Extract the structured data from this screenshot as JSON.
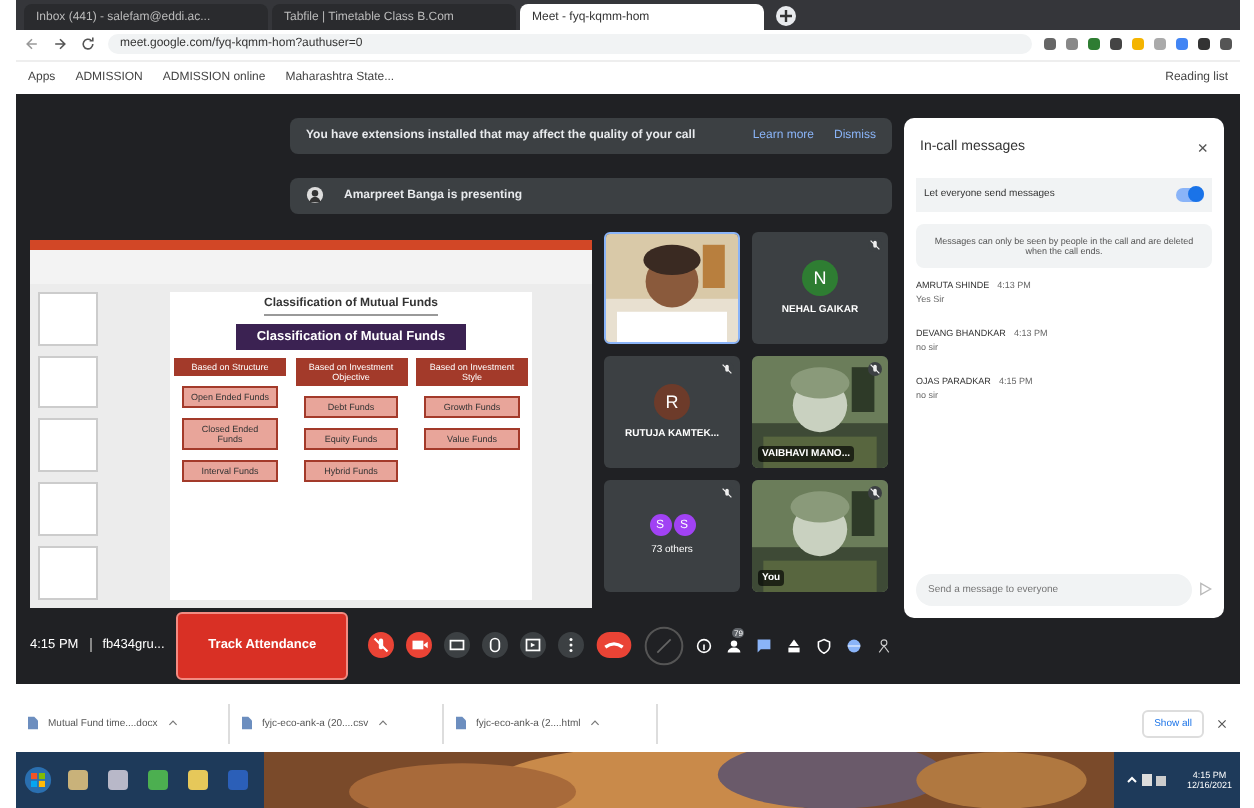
{
  "browser": {
    "tabs": [
      {
        "title": "Inbox (441) - salefam@eddi.ac...",
        "selected": false
      },
      {
        "title": "Tabfile | Timetable Class B.Com",
        "selected": false
      },
      {
        "title": "Meet - fyq-kqmm-hom",
        "selected": true
      }
    ],
    "address": "meet.google.com/fyq-kqmm-hom?authuser=0",
    "bookmarks": [
      "Apps",
      "ADMISSION",
      "ADMISSION online",
      "Maharashtra State..."
    ],
    "reading_list": "Reading list"
  },
  "meet": {
    "banner": {
      "text": "You have extensions installed that may affect the quality of your call",
      "links": [
        "Learn more",
        "Dismiss"
      ]
    },
    "presenting": "Amarpreet Banga is presenting",
    "slide": {
      "title": "Classification of Mutual Funds",
      "header": "Classification of Mutual Funds",
      "groups": [
        {
          "label": "Based on Structure",
          "items": [
            "Open Ended Funds",
            "Closed Ended Funds",
            "Interval Funds"
          ]
        },
        {
          "label": "Based on Investment Objective",
          "items": [
            "Debt Funds",
            "Equity Funds",
            "Hybrid Funds"
          ]
        },
        {
          "label": "Based on Investment Style",
          "items": [
            "Growth Funds",
            "Value Funds"
          ]
        }
      ]
    },
    "tiles": [
      {
        "kind": "video"
      },
      {
        "kind": "avatar",
        "name": "NEHAL GAIKAR",
        "initial": "N",
        "color": "#2e7d32"
      },
      {
        "kind": "avatar",
        "name": "RUTUJA KAMTEK...",
        "initial": "R",
        "color": "#6d3b2a"
      },
      {
        "kind": "video",
        "name": "VAIBHAVI MANO..."
      },
      {
        "kind": "others",
        "name": "73 others",
        "initials": [
          "S",
          "S"
        ]
      },
      {
        "kind": "video",
        "name": "You"
      }
    ],
    "time": "4:15 PM",
    "code": "fb434gru...",
    "track": "Track Attendance",
    "people_count": "79"
  },
  "chat": {
    "title": "In-call messages",
    "close": "×",
    "toggle": {
      "label": "Let everyone send messages",
      "on": true
    },
    "info": "Messages can only be seen by people in the call and are deleted when the call ends.",
    "messages": [
      {
        "sender": "AMRUTA SHINDE",
        "time": "4:13 PM",
        "text": "Yes Sir"
      },
      {
        "sender": "DEVANG BHANDKAR",
        "time": "4:13 PM",
        "text": "no sir"
      },
      {
        "sender": "OJAS PARADKAR",
        "time": "4:15 PM",
        "text": "no sir"
      }
    ],
    "placeholder": "Send a message to everyone"
  },
  "downloads": {
    "files": [
      "Mutual Fund time....docx",
      "fyjc-eco-ank-a (20....csv",
      "fyjc-eco-ank-a (2....html"
    ],
    "show_all": "Show all"
  },
  "taskbar": {
    "time": "4:15 PM",
    "date": "12/16/2021"
  }
}
